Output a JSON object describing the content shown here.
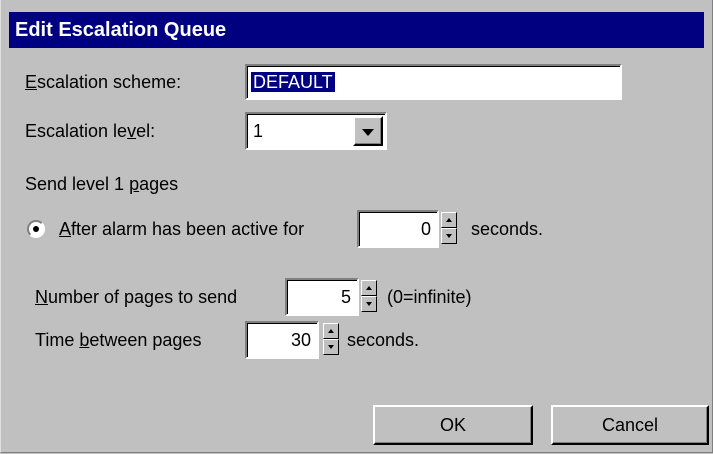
{
  "dialog": {
    "title": "Edit Escalation Queue",
    "colors": {
      "title_bg": "#000080",
      "face": "#c0c0c0",
      "selection": "#000080"
    }
  },
  "scheme": {
    "label_prefix": "",
    "label_mnemonic": "E",
    "label_rest": "scalation scheme:",
    "value": "DEFAULT"
  },
  "level": {
    "label_prefix": "Escalation le",
    "label_mnemonic": "v",
    "label_rest": "el:",
    "value": "1",
    "icon": "chevron-down-icon"
  },
  "send_group": {
    "label_prefix": "Send level 1 ",
    "label_mnemonic": "p",
    "label_rest": "ages"
  },
  "after_alarm": {
    "label_prefix": "",
    "label_mnemonic": "A",
    "label_rest": "fter alarm has been active for",
    "value": "0",
    "suffix": "seconds.",
    "selected": true
  },
  "num_pages": {
    "label_prefix": "",
    "label_mnemonic": "N",
    "label_rest": "umber of pages to send",
    "value": "5",
    "suffix": "(0=infinite)"
  },
  "time_between": {
    "label_prefix": "Time ",
    "label_mnemonic": "b",
    "label_rest": "etween pages",
    "value": "30",
    "suffix": "seconds."
  },
  "buttons": {
    "ok": "OK",
    "cancel": "Cancel"
  }
}
